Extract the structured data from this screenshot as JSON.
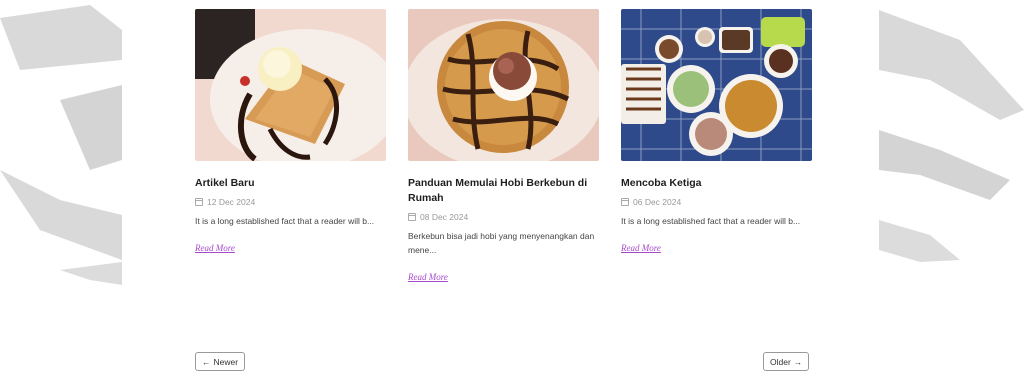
{
  "posts": [
    {
      "title": "Artikel Baru",
      "date": "12 Dec 2024",
      "excerpt": "It is a long established fact that a reader will b...",
      "read_more": "Read More",
      "image_icon": "waffle-ice-cream-image"
    },
    {
      "title": "Panduan Memulai Hobi Berkebun di Rumah",
      "date": "08 Dec 2024",
      "excerpt": "Berkebun bisa jadi hobi yang menyenangkan dan mene...",
      "read_more": "Read More",
      "image_icon": "chocolate-waffle-image"
    },
    {
      "title": "Mencoba Ketiga",
      "date": "06 Dec 2024",
      "excerpt": "It is a long established fact that a reader will b...",
      "read_more": "Read More",
      "image_icon": "food-spread-image"
    }
  ],
  "pagination": {
    "newer_label": "Newer",
    "newer_arrow": "←",
    "older_label": "Older",
    "older_arrow": "→"
  },
  "colors": {
    "accent": "#a64ac9",
    "meta_text": "#999999",
    "background_shapes": "#d9d9d9"
  }
}
